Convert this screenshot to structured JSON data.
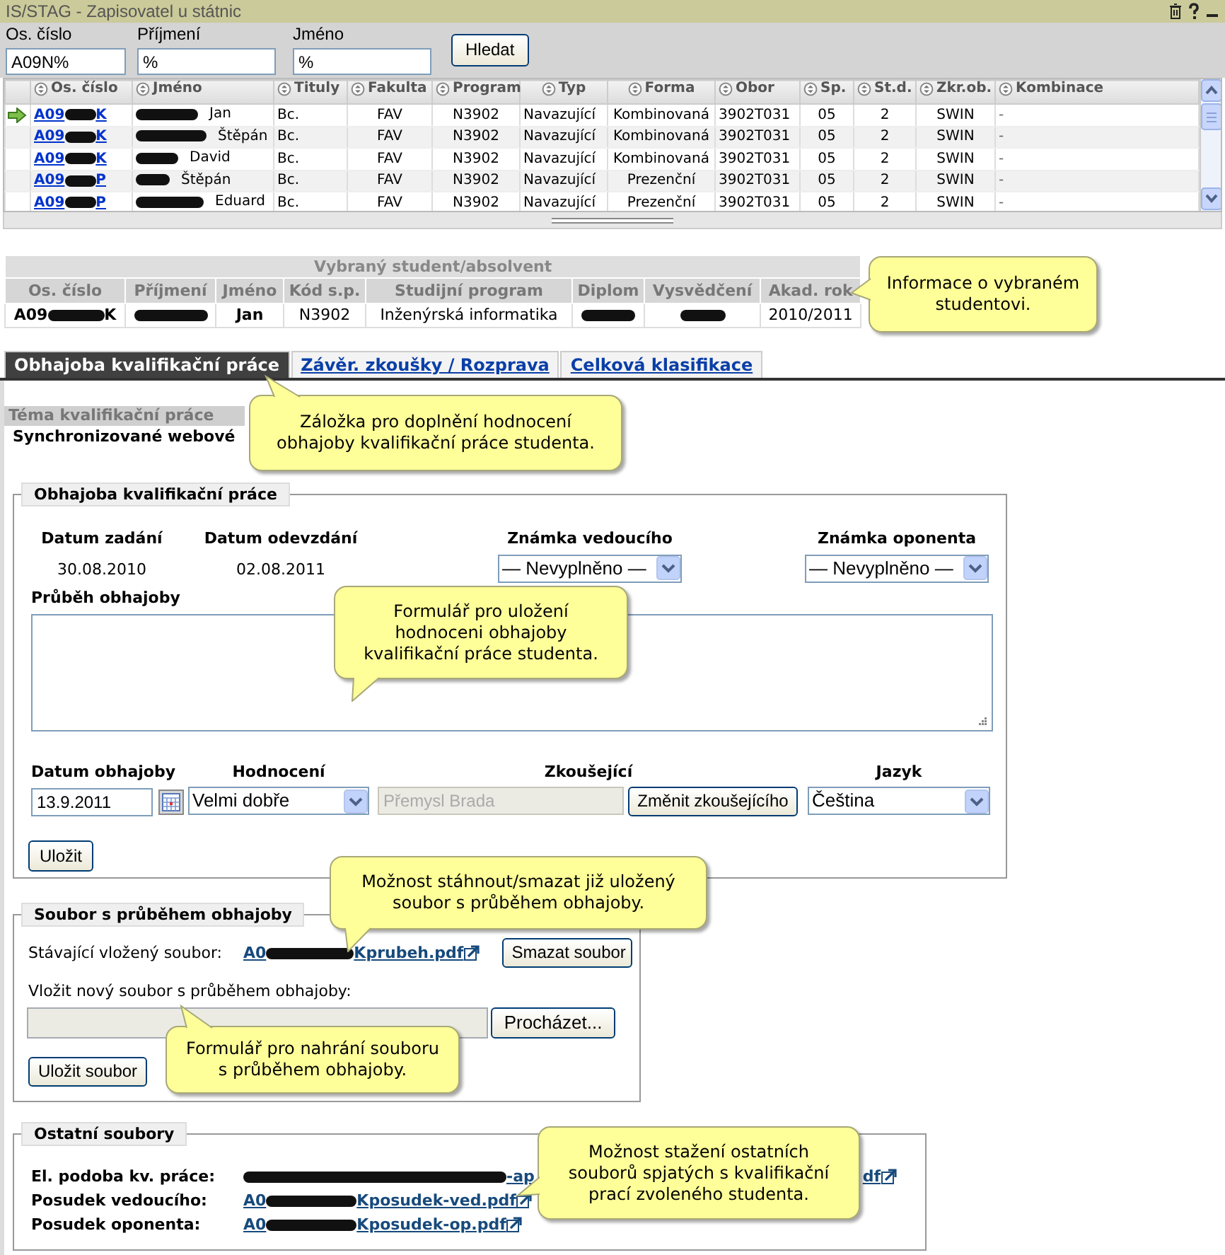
{
  "window": {
    "title": "IS/STAG - Zapisovatel u státnic"
  },
  "search": {
    "fields": [
      {
        "label": "Os. číslo",
        "value": "A09N%"
      },
      {
        "label": "Příjmení",
        "value": "%"
      },
      {
        "label": "Jméno",
        "value": "%"
      }
    ],
    "button": "Hledat"
  },
  "students": {
    "columns": [
      "Os. číslo",
      "Jméno",
      "Tituly",
      "Fakulta",
      "Program",
      "Typ",
      "Forma",
      "Obor",
      "Sp.",
      "St.d.",
      "Zkr.ob.",
      "Kombinace"
    ],
    "rows": [
      {
        "selected": true,
        "id_start": "A09",
        "id_end": "K",
        "name": "Jan",
        "values": [
          "Bc.",
          "FAV",
          "N3902",
          "Navazující",
          "Kombinovaná",
          "3902T031",
          "05",
          "2",
          "SWIN",
          "-"
        ]
      },
      {
        "selected": false,
        "id_start": "A09",
        "id_end": "K",
        "name": "Štěpán",
        "values": [
          "Bc.",
          "FAV",
          "N3902",
          "Navazující",
          "Kombinovaná",
          "3902T031",
          "05",
          "2",
          "SWIN",
          "-"
        ]
      },
      {
        "selected": false,
        "id_start": "A09",
        "id_end": "K",
        "name": "David",
        "values": [
          "Bc.",
          "FAV",
          "N3902",
          "Navazující",
          "Kombinovaná",
          "3902T031",
          "05",
          "2",
          "SWIN",
          "-"
        ]
      },
      {
        "selected": false,
        "id_start": "A09",
        "id_end": "P",
        "name": "Štěpán",
        "values": [
          "Bc.",
          "FAV",
          "N3902",
          "Navazující",
          "Prezenční",
          "3902T031",
          "05",
          "2",
          "SWIN",
          "-"
        ]
      },
      {
        "selected": false,
        "id_start": "A09",
        "id_end": "P",
        "name": "Eduard",
        "values": [
          "Bc.",
          "FAV",
          "N3902",
          "Navazující",
          "Prezenční",
          "3902T031",
          "05",
          "2",
          "SWIN",
          "-"
        ]
      }
    ]
  },
  "selected_student": {
    "title": "Vybraný student/absolvent",
    "columns": [
      "Os. číslo",
      "Příjmení",
      "Jméno",
      "Kód s.p.",
      "Studijní program",
      "Diplom",
      "Vysvědčení",
      "Akad. rok"
    ],
    "id_start": "A09",
    "id_end": "K",
    "first_name": "Jan",
    "code": "N3902",
    "program": "Inženýrská informatika",
    "year": "2010/2011"
  },
  "tabs": [
    {
      "label": "Obhajoba kvalifikační práce",
      "selected": true
    },
    {
      "label": "Závěr. zkoušky / Rozprava",
      "selected": false
    },
    {
      "label": "Celková klasifikace",
      "selected": false
    }
  ],
  "topic": {
    "label": "Téma kvalifikační práce",
    "value": "Synchronizované webové"
  },
  "defense": {
    "legend": "Obhajoba kvalifikační práce",
    "assigned_label": "Datum zadání",
    "assigned": "30.08.2010",
    "submitted_label": "Datum odevzdání",
    "submitted": "02.08.2011",
    "supervisor_grade": {
      "label": "Známka vedoucího",
      "value": "— Nevyplněno —"
    },
    "opponent_grade": {
      "label": "Známka oponenta",
      "value": "— Nevyplněno —"
    },
    "progress_label": "Průběh obhajoby",
    "date": {
      "label": "Datum obhajoby",
      "value": "13.9.2011"
    },
    "evaluation": {
      "label": "Hodnocení",
      "value": "Velmi dobře"
    },
    "examiner": {
      "label": "Zkoušející",
      "value": "Přemysl Brada",
      "disabled": true,
      "button": "Změnit zkoušejícího"
    },
    "language": {
      "label": "Jazyk",
      "value": "Čeština"
    },
    "save": "Uložit"
  },
  "defense_file": {
    "legend": "Soubor s průběhem obhajoby",
    "current_label": "Stávající vložený soubor:",
    "current_start": "A0",
    "current_end": "Kprubeh.pdf",
    "delete": "Smazat soubor",
    "new_label": "Vložit nový soubor s průběhem obhajoby:",
    "browse": "Procházet...",
    "save": "Uložit soubor"
  },
  "other_files": {
    "legend": "Ostatní soubory",
    "items": [
      {
        "kind": "partial",
        "label": "El. podoba kv. práce:",
        "parts": [
          "-ap",
          "df"
        ]
      },
      {
        "kind": "file",
        "label": "Posudek vedoucího:",
        "start": "A0",
        "end": "Kposudek-ved.pdf"
      },
      {
        "kind": "file",
        "label": "Posudek oponenta:",
        "start": "A0",
        "end": "Kposudek-op.pdf"
      }
    ]
  },
  "callouts": [
    "Informace o vybraném\nstudentovi.",
    "Záložka pro doplnění hodnocení\nobhajoby kvalifikační práce studenta.",
    "Formulář pro uložení\nhodnoceni obhajoby\nkvalifikační práce studenta.",
    "Možnost stáhnout/smazat již uložený\nsoubor s průběhem obhajoby.",
    "Formulář pro nahrání souboru\ns průběhem obhajoby.",
    "Možnost stažení ostatních\nsouborů spjatých s kvalifikační\nprací zvoleného studenta."
  ]
}
